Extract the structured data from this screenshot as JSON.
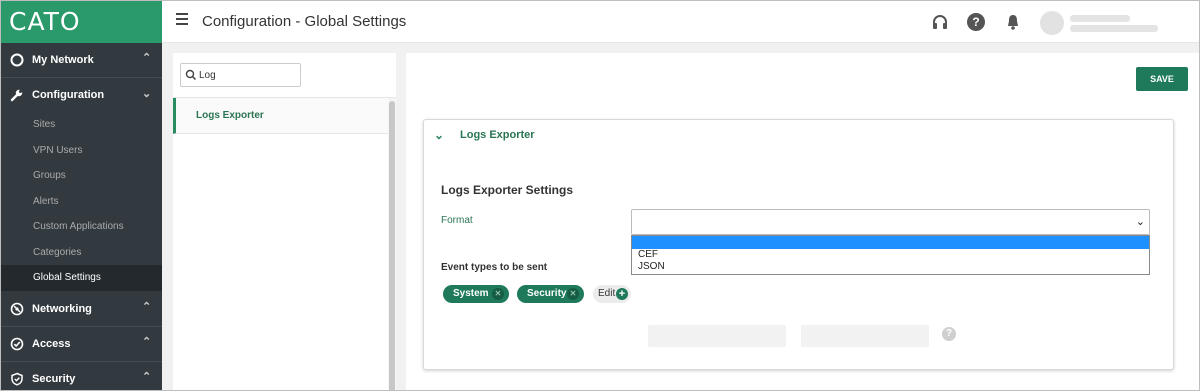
{
  "app": {
    "logo": "CATO"
  },
  "header": {
    "title": "Configuration - Global Settings"
  },
  "sidebar": {
    "sections": [
      {
        "label": "My Network",
        "icon": "circle-icon"
      },
      {
        "label": "Configuration",
        "icon": "wrench-icon"
      },
      {
        "label": "Networking",
        "icon": "networking-icon"
      },
      {
        "label": "Access",
        "icon": "check-circle-icon"
      },
      {
        "label": "Security",
        "icon": "shield-icon"
      }
    ],
    "config_items": [
      "Sites",
      "VPN Users",
      "Groups",
      "Alerts",
      "Custom Applications",
      "Categories",
      "Global Settings"
    ]
  },
  "search": {
    "value": "Log"
  },
  "left_list": {
    "items": [
      "Logs Exporter"
    ]
  },
  "main": {
    "save_label": "SAVE",
    "panel_title": "Logs Exporter",
    "settings_title": "Logs Exporter Settings",
    "format_label": "Format",
    "format_options": [
      "",
      "CEF",
      "JSON"
    ],
    "event_types_label": "Event types to be sent",
    "event_types": [
      "System",
      "Security"
    ],
    "edit_label": "Edit"
  },
  "colors": {
    "brand": "#2a9a6b",
    "accent": "#1e7a5a",
    "sidebar_bg": "#333a3f",
    "highlight": "#1e90ff"
  }
}
